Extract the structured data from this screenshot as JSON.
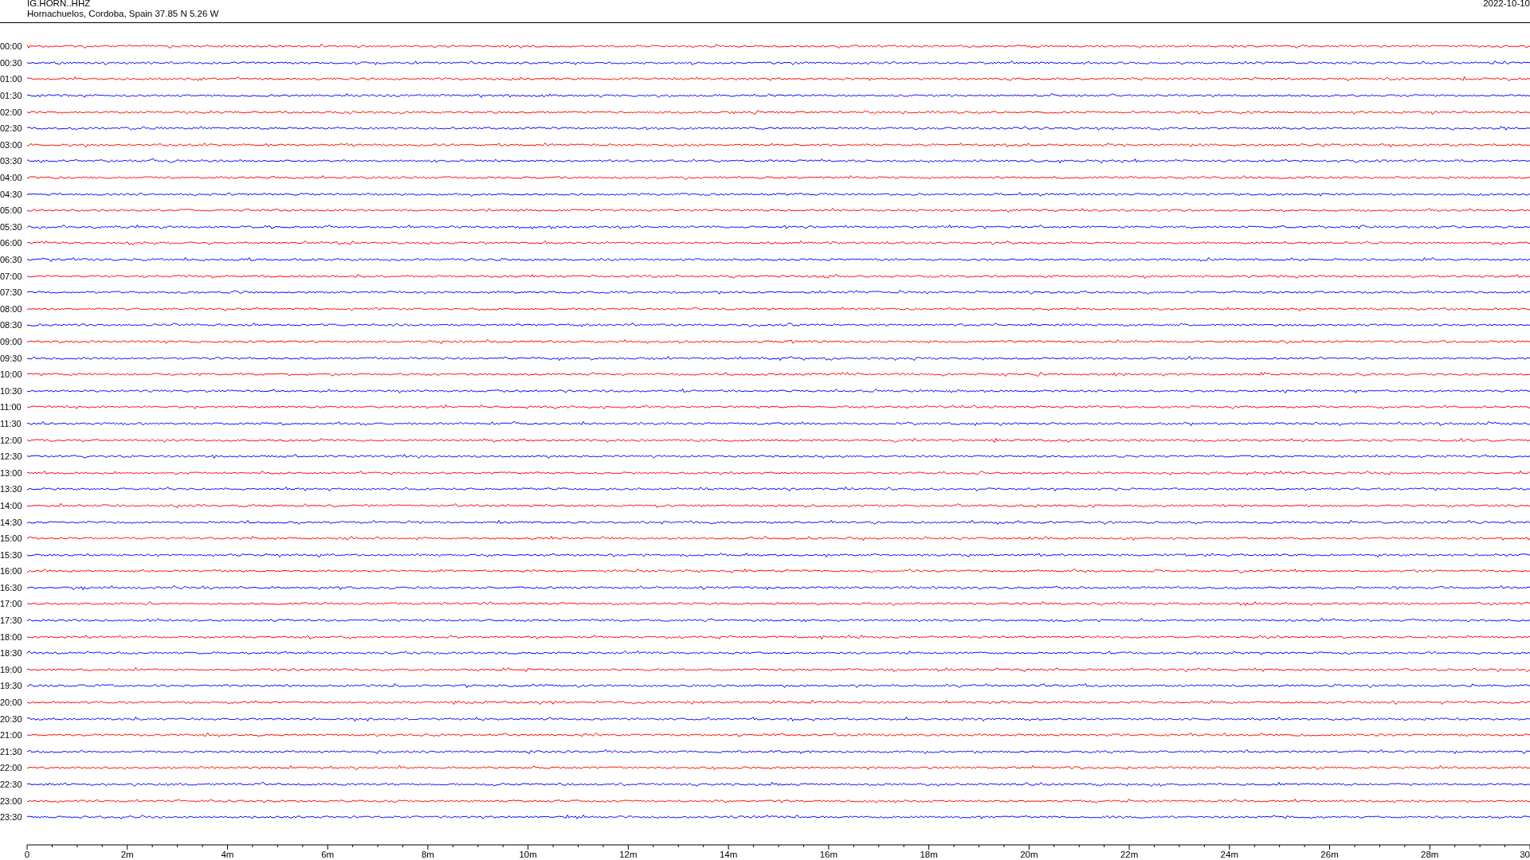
{
  "header": {
    "station": "IG.HORN..HHZ",
    "location": "Hornachuelos, Cordoba, Spain  37.85 N 5.26 W",
    "date": "2022-10-10"
  },
  "rows": [
    {
      "time": "00:00",
      "color": "#ff0000"
    },
    {
      "time": "00:30",
      "color": "#0000ff"
    },
    {
      "time": "01:00",
      "color": "#ff0000"
    },
    {
      "time": "01:30",
      "color": "#0000ff"
    },
    {
      "time": "02:00",
      "color": "#ff0000"
    },
    {
      "time": "02:30",
      "color": "#0000ff"
    },
    {
      "time": "03:00",
      "color": "#ff0000"
    },
    {
      "time": "03:30",
      "color": "#0000ff"
    },
    {
      "time": "04:00",
      "color": "#ff0000"
    },
    {
      "time": "04:30",
      "color": "#0000ff"
    },
    {
      "time": "05:00",
      "color": "#ff0000"
    },
    {
      "time": "05:30",
      "color": "#0000ff"
    },
    {
      "time": "06:00",
      "color": "#ff0000"
    },
    {
      "time": "06:30",
      "color": "#0000ff"
    },
    {
      "time": "07:00",
      "color": "#ff0000"
    },
    {
      "time": "07:30",
      "color": "#0000ff"
    },
    {
      "time": "08:00",
      "color": "#ff0000"
    },
    {
      "time": "08:30",
      "color": "#0000ff"
    },
    {
      "time": "09:00",
      "color": "#ff0000"
    },
    {
      "time": "09:30",
      "color": "#0000ff"
    },
    {
      "time": "10:00",
      "color": "#ff0000"
    },
    {
      "time": "10:30",
      "color": "#0000ff"
    },
    {
      "time": "11:00",
      "color": "#ff0000"
    },
    {
      "time": "11:30",
      "color": "#0000ff"
    },
    {
      "time": "12:00",
      "color": "#ff0000"
    },
    {
      "time": "12:30",
      "color": "#0000ff"
    },
    {
      "time": "13:00",
      "color": "#ff0000"
    },
    {
      "time": "13:30",
      "color": "#0000ff"
    },
    {
      "time": "14:00",
      "color": "#ff0000"
    },
    {
      "time": "14:30",
      "color": "#0000ff"
    },
    {
      "time": "15:00",
      "color": "#ff0000"
    },
    {
      "time": "15:30",
      "color": "#0000ff"
    },
    {
      "time": "16:00",
      "color": "#ff0000"
    },
    {
      "time": "16:30",
      "color": "#0000ff"
    },
    {
      "time": "17:00",
      "color": "#ff0000"
    },
    {
      "time": "17:30",
      "color": "#0000ff"
    },
    {
      "time": "18:00",
      "color": "#ff0000"
    },
    {
      "time": "18:30",
      "color": "#0000ff"
    },
    {
      "time": "19:00",
      "color": "#ff0000"
    },
    {
      "time": "19:30",
      "color": "#0000ff"
    },
    {
      "time": "20:00",
      "color": "#ff0000"
    },
    {
      "time": "20:30",
      "color": "#0000ff"
    },
    {
      "time": "21:00",
      "color": "#ff0000"
    },
    {
      "time": "21:30",
      "color": "#0000ff"
    },
    {
      "time": "22:00",
      "color": "#ff0000"
    },
    {
      "time": "22:30",
      "color": "#0000ff"
    },
    {
      "time": "23:00",
      "color": "#ff0000"
    },
    {
      "time": "23:30",
      "color": "#0000ff"
    }
  ],
  "x_axis": {
    "labels": [
      "0",
      "2m",
      "4m",
      "6m",
      "8m",
      "10m",
      "12m",
      "14m",
      "16m",
      "18m",
      "20m",
      "22m",
      "24m",
      "26m",
      "28m",
      "30"
    ]
  }
}
